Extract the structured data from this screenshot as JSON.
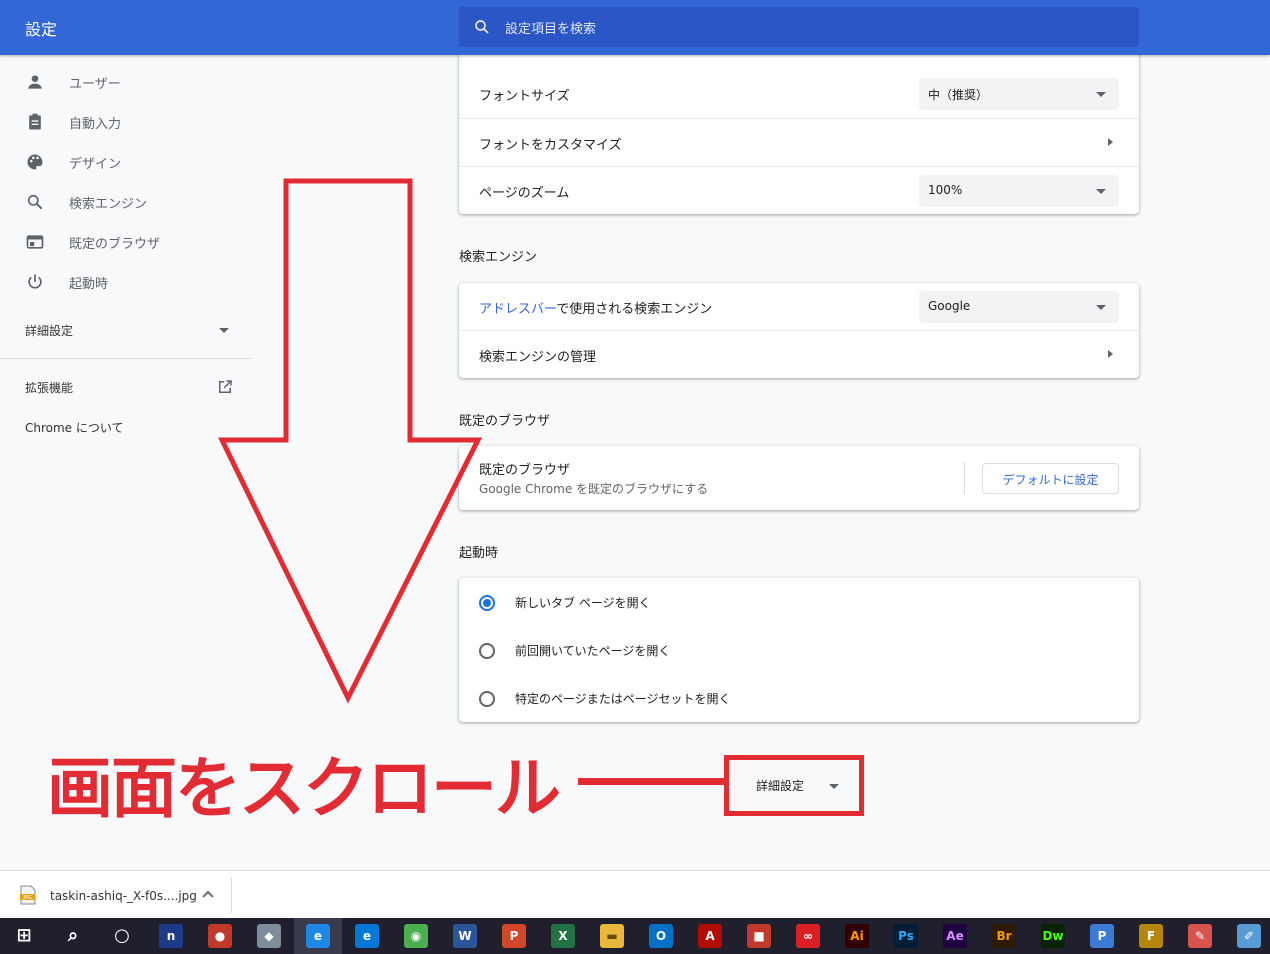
{
  "header": {
    "title": "設定",
    "search_placeholder": "設定項目を検索"
  },
  "sidebar": {
    "items": [
      {
        "label": "ユーザー",
        "icon": "person-icon"
      },
      {
        "label": "自動入力",
        "icon": "clipboard-icon"
      },
      {
        "label": "デザイン",
        "icon": "palette-icon"
      },
      {
        "label": "検索エンジン",
        "icon": "search-icon"
      },
      {
        "label": "既定のブラウザ",
        "icon": "browser-window-icon"
      },
      {
        "label": "起動時",
        "icon": "power-icon"
      }
    ],
    "advanced_label": "詳細設定",
    "extensions_label": "拡張機能",
    "about_label": "Chrome について"
  },
  "appearance_card": {
    "font_size_label": "フォントサイズ",
    "font_size_value": "中（推奨）",
    "customize_fonts_label": "フォントをカスタマイズ",
    "page_zoom_label": "ページのズーム",
    "page_zoom_value": "100%"
  },
  "search_engine": {
    "section_title": "検索エンジン",
    "address_bar_link": "アドレスバー",
    "address_bar_rest": "で使用される検索エンジン",
    "engine_value": "Google",
    "manage_label": "検索エンジンの管理"
  },
  "default_browser": {
    "section_title": "既定のブラウザ",
    "title": "既定のブラウザ",
    "subtitle": "Google Chrome を既定のブラウザにする",
    "button_label": "デフォルトに設定"
  },
  "on_startup": {
    "section_title": "起動時",
    "options": [
      {
        "label": "新しいタブ ページを開く",
        "selected": true
      },
      {
        "label": "前回開いていたページを開く",
        "selected": false
      },
      {
        "label": "特定のページまたはページセットを開く",
        "selected": false
      }
    ]
  },
  "annotation": {
    "text": "画面をスクロール",
    "advanced_button_label": "詳細設定",
    "color": "#e32b33"
  },
  "download_bar": {
    "file_name": "taskin-ashiq-_X-f0s....jpg"
  },
  "taskbar": {
    "items": [
      {
        "icon": "windows-start-icon",
        "glyph": "⊞"
      },
      {
        "icon": "taskbar-search-icon",
        "glyph": "⌕"
      },
      {
        "icon": "task-view-icon",
        "glyph": "○"
      },
      {
        "icon": "app-n-icon",
        "glyph": "n"
      },
      {
        "icon": "app-ladybug-icon",
        "glyph": "●"
      },
      {
        "icon": "app-fish-icon",
        "glyph": "◆"
      },
      {
        "icon": "internet-explorer-icon",
        "glyph": "e"
      },
      {
        "icon": "edge-icon",
        "glyph": "e"
      },
      {
        "icon": "chrome-icon",
        "glyph": "◉"
      },
      {
        "icon": "word-icon",
        "glyph": "W"
      },
      {
        "icon": "powerpoint-icon",
        "glyph": "P"
      },
      {
        "icon": "excel-icon",
        "glyph": "X"
      },
      {
        "icon": "file-explorer-icon",
        "glyph": "▬"
      },
      {
        "icon": "outlook-icon",
        "glyph": "O"
      },
      {
        "icon": "acrobat-icon",
        "glyph": "A"
      },
      {
        "icon": "app-cube-icon",
        "glyph": "■"
      },
      {
        "icon": "creative-cloud-icon",
        "glyph": "∞"
      },
      {
        "icon": "illustrator-icon",
        "glyph": "Ai"
      },
      {
        "icon": "photoshop-icon",
        "glyph": "Ps"
      },
      {
        "icon": "after-effects-icon",
        "glyph": "Ae"
      },
      {
        "icon": "bridge-icon",
        "glyph": "Br"
      },
      {
        "icon": "dreamweaver-icon",
        "glyph": "Dw"
      },
      {
        "icon": "app-p-icon",
        "glyph": "P"
      },
      {
        "icon": "ftp-icon",
        "glyph": "F"
      },
      {
        "icon": "paint-icon",
        "glyph": "✎"
      },
      {
        "icon": "app-brush-icon",
        "glyph": "✐"
      }
    ],
    "colors": [
      "#ffffff",
      "#ffffff",
      "#ffffff",
      "#1e3a8a",
      "#c0392b",
      "#7f8c9a",
      "#1e88e5",
      "#0078d7",
      "#4caf50",
      "#2b579a",
      "#d24726",
      "#217346",
      "#e8b73c",
      "#0072c6",
      "#b30b00",
      "#c0392b",
      "#da1f26",
      "#330000",
      "#001e36",
      "#1f0040",
      "#2d1a00",
      "#072401",
      "#3a7bd5",
      "#b8860b",
      "#d9534f",
      "#5b9bd5"
    ],
    "fg": [
      "#ffffff",
      "#ffffff",
      "#ffffff",
      "#ffffff",
      "#ffffff",
      "#ffffff",
      "#ffffff",
      "#ffffff",
      "#ffffff",
      "#ffffff",
      "#ffffff",
      "#ffffff",
      "#6b4a10",
      "#ffffff",
      "#ffffff",
      "#ffffff",
      "#ffffff",
      "#ff9a00",
      "#31a8ff",
      "#d291ff",
      "#ff9a00",
      "#4aff00",
      "#ffffff",
      "#ffffff",
      "#ffffff",
      "#ffffff"
    ]
  }
}
